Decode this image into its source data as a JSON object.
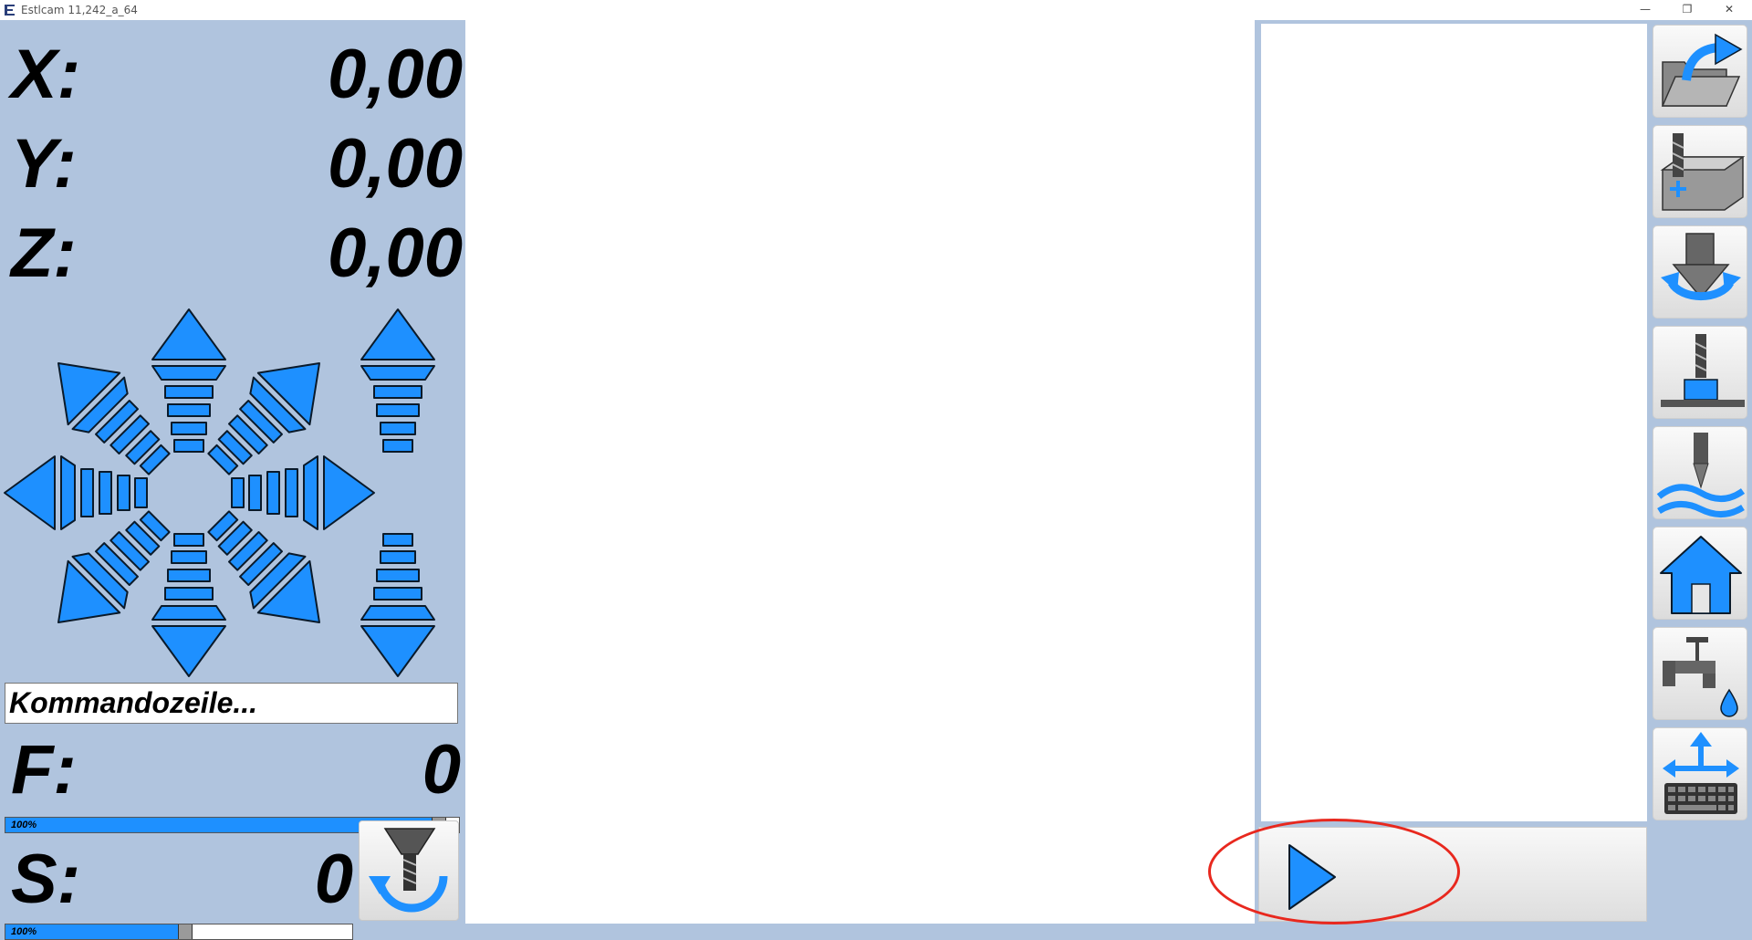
{
  "window": {
    "title": "Estlcam 11,242_a_64",
    "minimize_glyph": "—",
    "restore_glyph": "❐",
    "close_glyph": "✕"
  },
  "axes": [
    {
      "label": "X:",
      "value": "0,00"
    },
    {
      "label": "Y:",
      "value": "0,00"
    },
    {
      "label": "Z:",
      "value": "0,00"
    }
  ],
  "command_line": {
    "placeholder": "Kommandozeile..."
  },
  "feed": {
    "label": "F:",
    "value": "0",
    "override_text": "100%",
    "override_fraction": 0.97
  },
  "spindle": {
    "label": "S:",
    "value": "0",
    "override_text": "100%",
    "override_fraction": 0.52
  },
  "colors": {
    "accent": "#1e90ff",
    "panel_bg": "#b0c4de",
    "annotation": "#e8281e"
  },
  "icons": {
    "jog": [
      "jog-up-left-arrow-icon",
      "jog-up-arrow-icon",
      "jog-up-right-arrow-icon",
      "jog-left-arrow-icon",
      "jog-right-arrow-icon",
      "jog-down-left-arrow-icon",
      "jog-down-arrow-icon",
      "jog-down-right-arrow-icon",
      "z-up-arrow-icon",
      "z-down-arrow-icon"
    ],
    "toolbar": [
      "open-file-icon",
      "set-workpiece-zero-icon",
      "tool-change-icon",
      "tool-length-probe-icon",
      "surface-probe-icon",
      "home-icon",
      "coolant-icon",
      "keyboard-jog-icon"
    ],
    "spindle_button": "spindle-toggle-icon",
    "play_button": "play-icon"
  }
}
